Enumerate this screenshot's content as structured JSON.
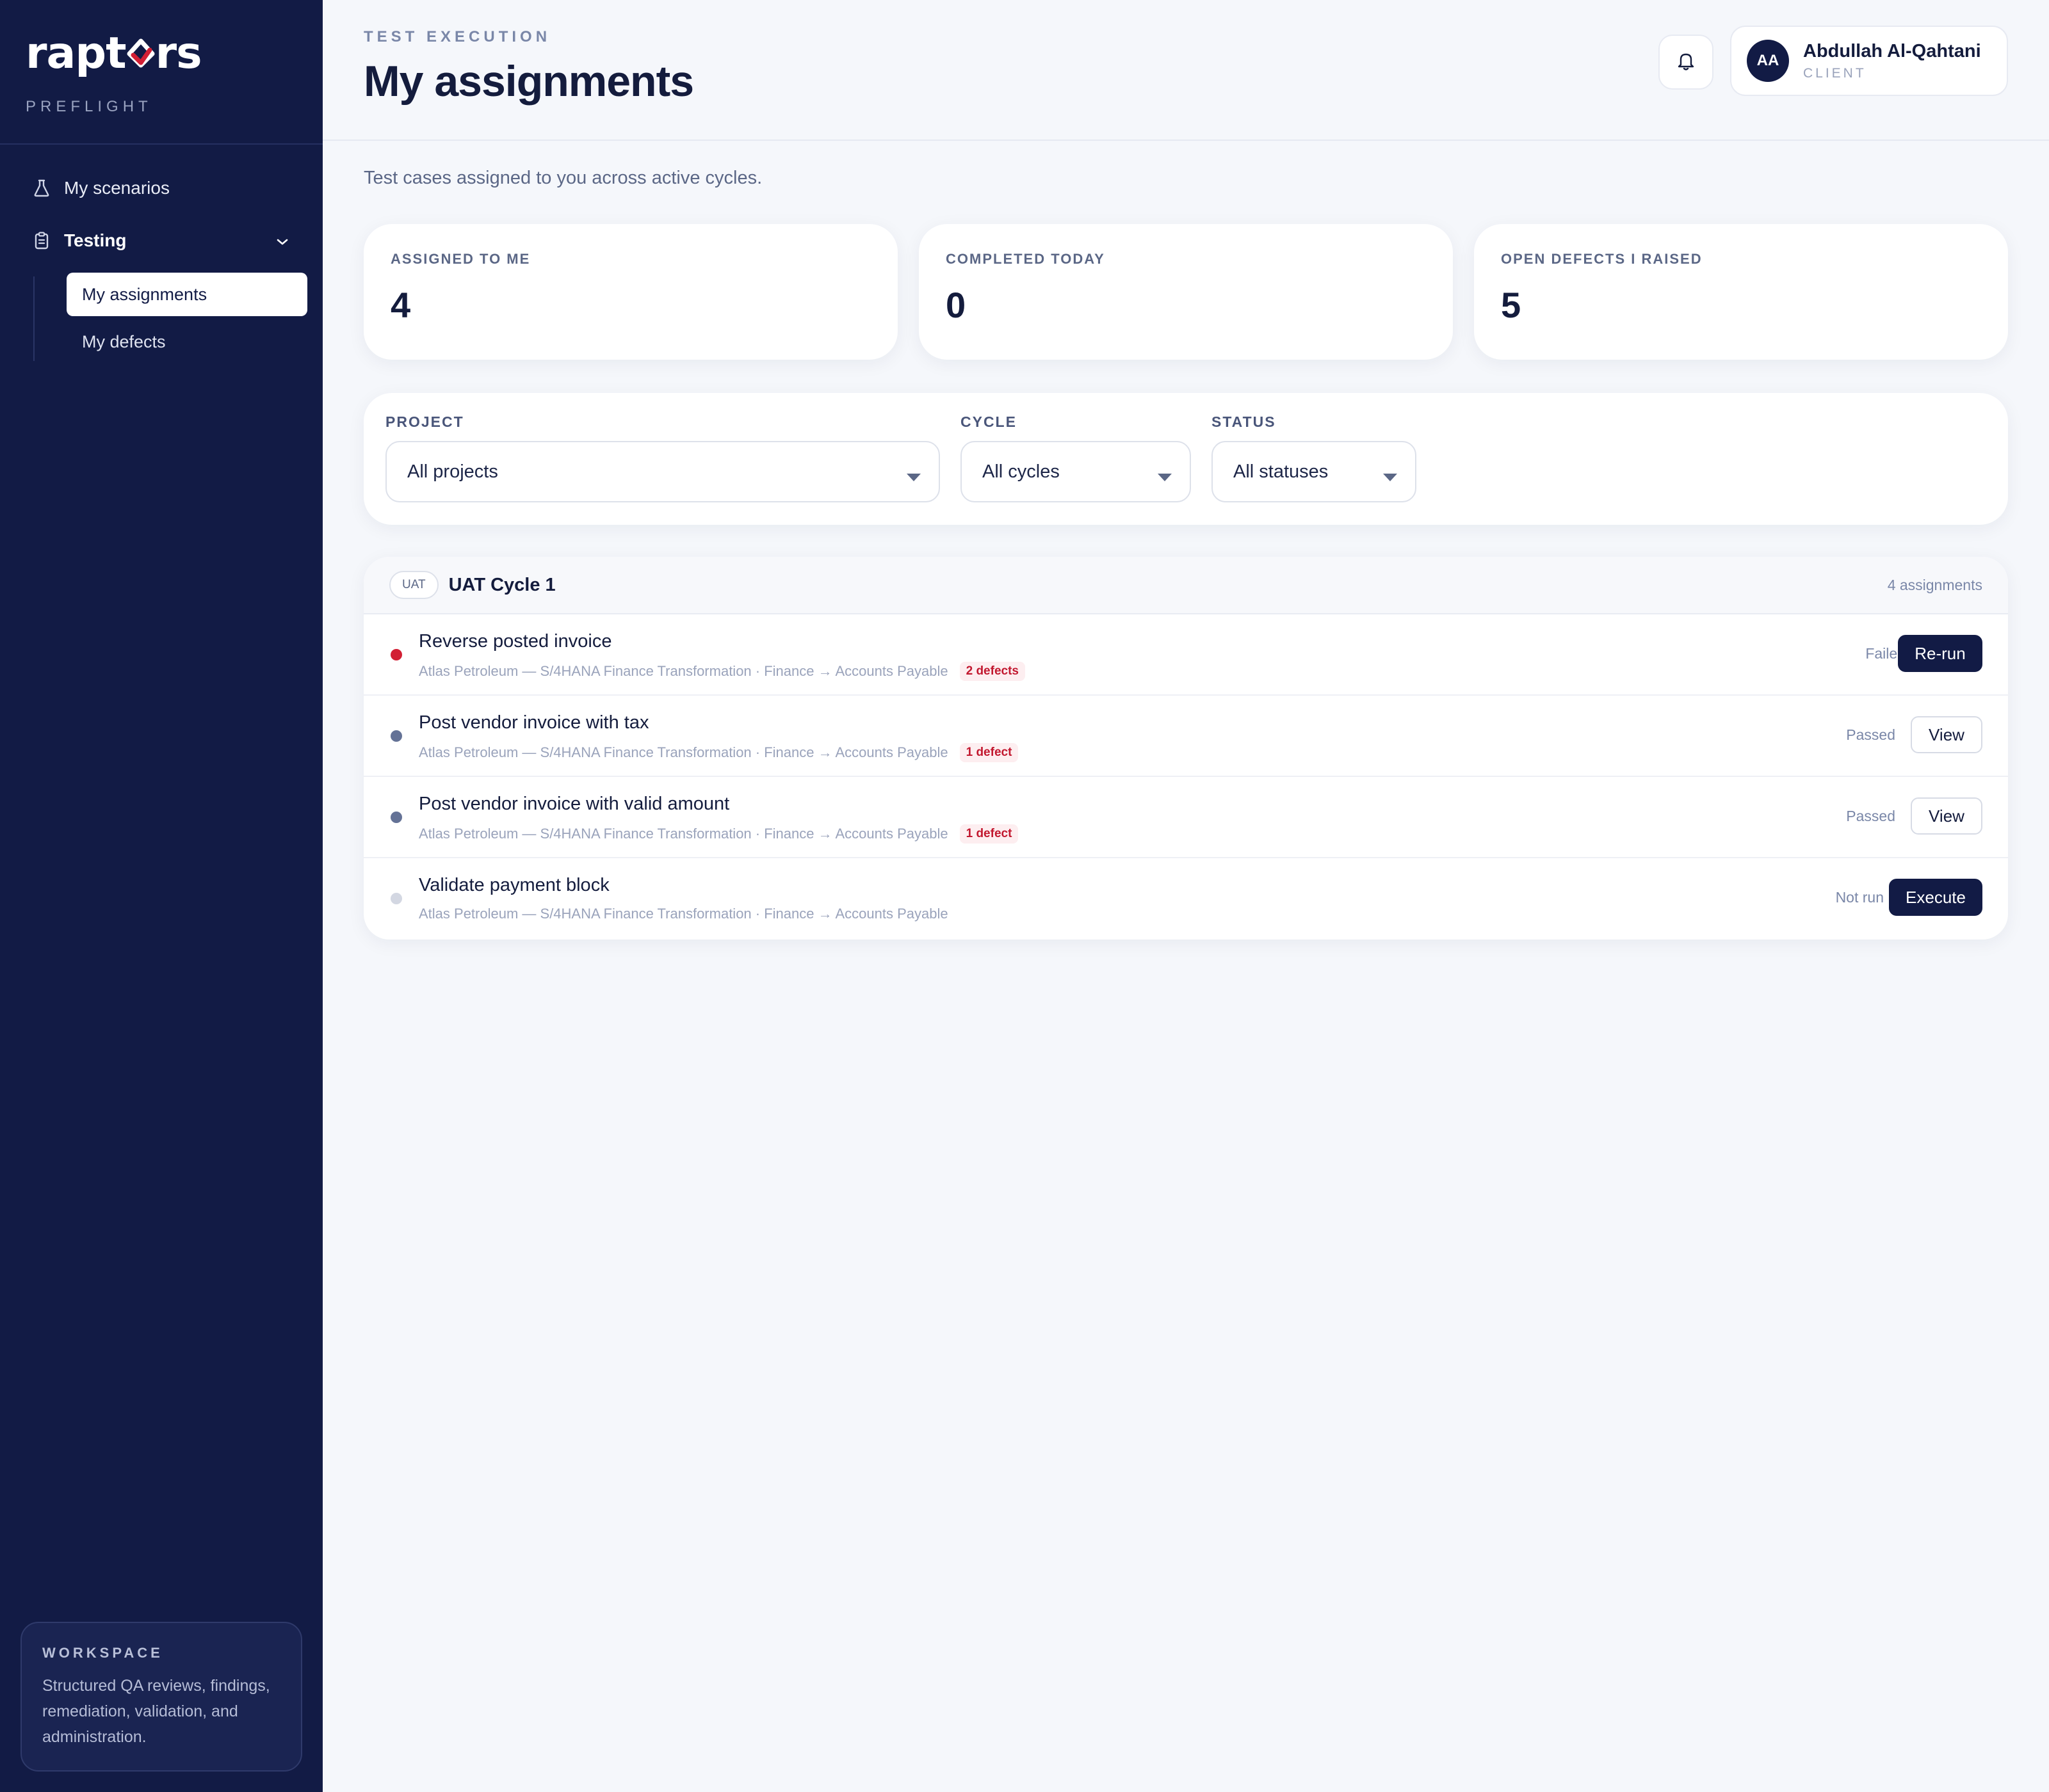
{
  "brand": {
    "logo_prefix": "rapt",
    "logo_suffix": "rs",
    "product": "PREFLIGHT"
  },
  "sidebar": {
    "items": [
      {
        "label": "My scenarios",
        "icon": "flask-icon"
      },
      {
        "label": "Testing",
        "icon": "clipboard-icon",
        "expanded": true
      }
    ],
    "subitems": [
      {
        "label": "My assignments",
        "active": true
      },
      {
        "label": "My defects",
        "active": false
      }
    ],
    "workspace": {
      "title": "WORKSPACE",
      "text": "Structured QA reviews, findings, remediation, validation, and administration."
    }
  },
  "header": {
    "eyebrow": "TEST EXECUTION",
    "title": "My assignments",
    "user": {
      "initials": "AA",
      "name": "Abdullah Al-Qahtani",
      "role": "CLIENT"
    }
  },
  "main": {
    "subtitle": "Test cases assigned to you across active cycles.",
    "stats": [
      {
        "label": "ASSIGNED TO ME",
        "value": "4"
      },
      {
        "label": "COMPLETED TODAY",
        "value": "0"
      },
      {
        "label": "OPEN DEFECTS I RAISED",
        "value": "5"
      }
    ],
    "filters": {
      "project": {
        "label": "PROJECT",
        "value": "All projects"
      },
      "cycle": {
        "label": "CYCLE",
        "value": "All cycles"
      },
      "status": {
        "label": "STATUS",
        "value": "All statuses"
      }
    },
    "cycle": {
      "badge": "UAT",
      "name": "UAT Cycle 1",
      "count": "4 assignments",
      "rows": [
        {
          "title": "Reverse posted invoice",
          "meta": "Atlas Petroleum — S/4HANA Finance Transformation · Finance → Accounts Payable",
          "defects": "2 defects",
          "status": "Failed",
          "action": "Re-run",
          "dot_color": "#d21f34"
        },
        {
          "title": "Post vendor invoice with tax",
          "meta": "Atlas Petroleum — S/4HANA Finance Transformation · Finance → Accounts Payable",
          "defects": "1 defect",
          "status": "Passed",
          "action": "View",
          "dot_color": "#647296"
        },
        {
          "title": "Post vendor invoice with valid amount",
          "meta": "Atlas Petroleum — S/4HANA Finance Transformation · Finance → Accounts Payable",
          "defects": "1 defect",
          "status": "Passed",
          "action": "View",
          "dot_color": "#647296"
        },
        {
          "title": "Validate payment block",
          "meta": "Atlas Petroleum — S/4HANA Finance Transformation · Finance → Accounts Payable",
          "defects": "",
          "status": "Not run",
          "action": "Execute",
          "dot_color": "#d3d7e2"
        }
      ]
    }
  },
  "colors": {
    "sidebar": "#121b45",
    "accent_red": "#d21f34",
    "background": "#f5f7fb"
  }
}
